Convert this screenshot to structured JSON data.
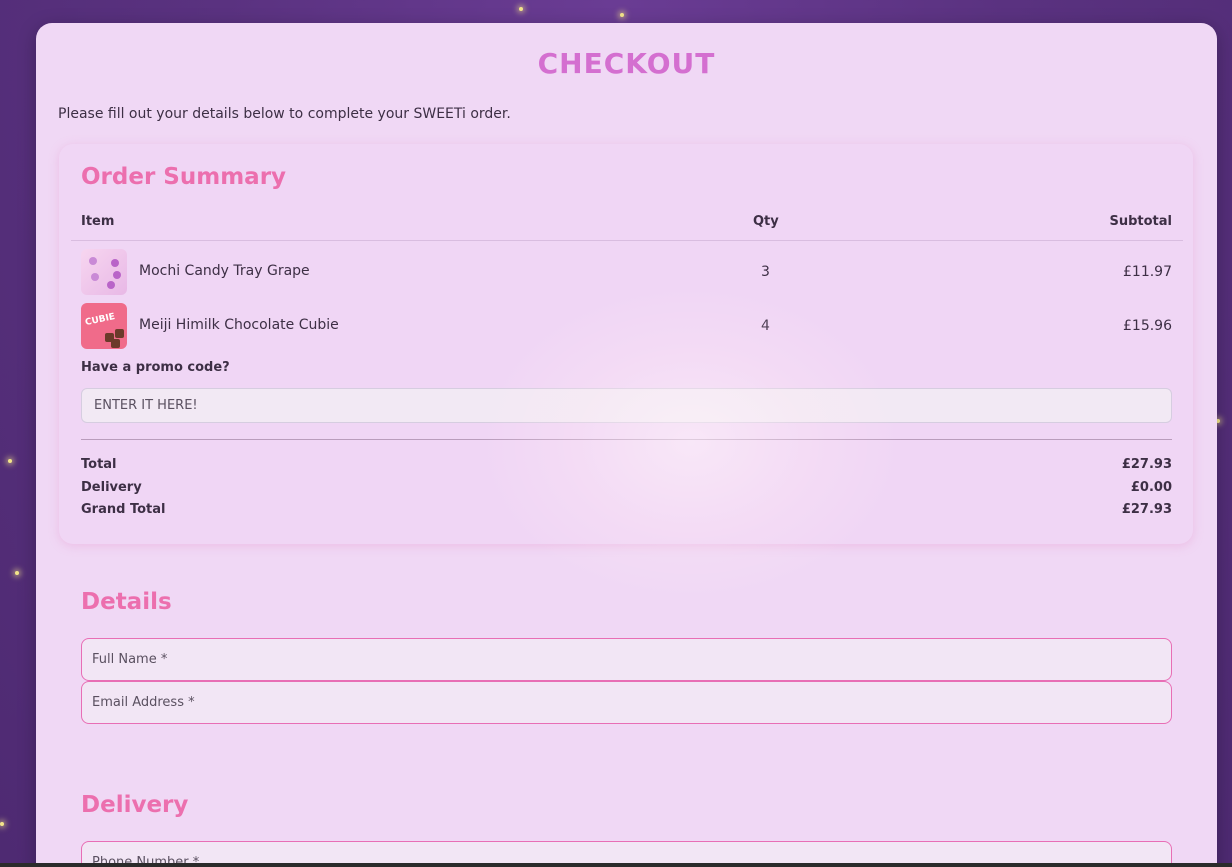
{
  "page": {
    "title": "CHECKOUT",
    "intro": "Please fill out your details below to complete your SWEETi order."
  },
  "order_summary": {
    "title": "Order Summary",
    "columns": {
      "item": "Item",
      "qty": "Qty",
      "subtotal": "Subtotal"
    },
    "items": [
      {
        "name": "Mochi Candy Tray Grape",
        "qty": "3",
        "subtotal": "£11.97"
      },
      {
        "name": "Meiji Himilk Chocolate Cubie",
        "qty": "4",
        "subtotal": "£15.96",
        "thumb_text": "CUBIE"
      }
    ],
    "promo": {
      "label": "Have a promo code?",
      "placeholder": "ENTER IT HERE!"
    },
    "totals": {
      "total_label": "Total",
      "total_value": "£27.93",
      "delivery_label": "Delivery",
      "delivery_value": "£0.00",
      "grand_label": "Grand Total",
      "grand_value": "£27.93"
    }
  },
  "details": {
    "title": "Details",
    "full_name_placeholder": "Full Name *",
    "email_placeholder": "Email Address *"
  },
  "delivery": {
    "title": "Delivery",
    "phone_placeholder": "Phone Number *"
  },
  "colors": {
    "accent_title": "#d46fd0",
    "section_title": "#ec6fae",
    "field_border": "#e86eb5",
    "background": "#5a3280"
  }
}
